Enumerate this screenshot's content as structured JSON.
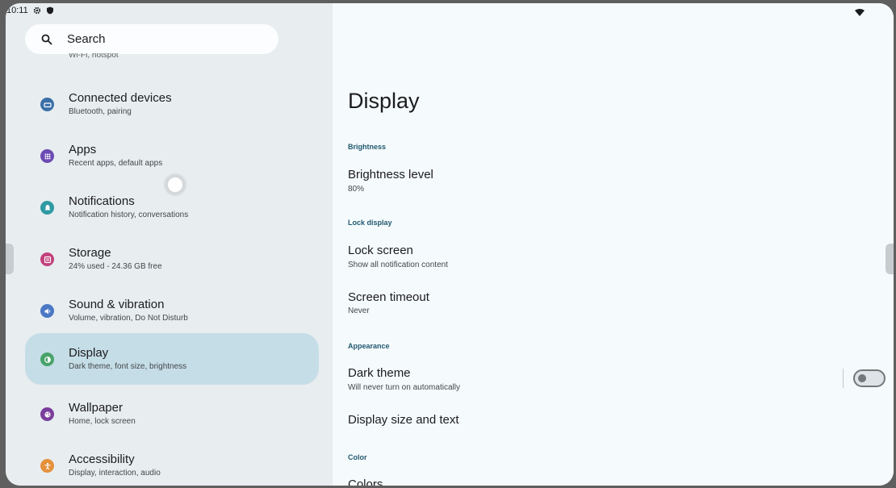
{
  "status_bar": {
    "time": "10:11",
    "icons": [
      "gear-icon",
      "shield-icon"
    ],
    "right_icons": [
      "wifi-icon"
    ]
  },
  "search": {
    "label": "Search",
    "icon": "search-icon"
  },
  "clipped_above": "Wi-Fi, hotspot",
  "sidebar": {
    "items": [
      {
        "title": "Connected devices",
        "subtitle": "Bluetooth, pairing",
        "icon": "connected-devices-icon",
        "color": "#3b6fa8"
      },
      {
        "title": "Apps",
        "subtitle": "Recent apps, default apps",
        "icon": "apps-icon",
        "color": "#6c4bb3"
      },
      {
        "title": "Notifications",
        "subtitle": "Notification history, conversations",
        "icon": "bell-icon",
        "color": "#2e9aa3"
      },
      {
        "title": "Storage",
        "subtitle": "24% used - 24.36 GB free",
        "icon": "storage-icon",
        "color": "#c2417b"
      },
      {
        "title": "Sound & vibration",
        "subtitle": "Volume, vibration, Do Not Disturb",
        "icon": "volume-icon",
        "color": "#4a78c4"
      },
      {
        "title": "Display",
        "subtitle": "Dark theme, font size, brightness",
        "icon": "brightness-icon",
        "color": "#48a36a",
        "selected": true
      },
      {
        "title": "Wallpaper",
        "subtitle": "Home, lock screen",
        "icon": "palette-icon",
        "color": "#7a3e9d"
      },
      {
        "title": "Accessibility",
        "subtitle": "Display, interaction, audio",
        "icon": "accessibility-icon",
        "color": "#e5913b"
      }
    ]
  },
  "main": {
    "title": "Display",
    "sections": {
      "brightness": "Brightness",
      "lock_display": "Lock display",
      "appearance": "Appearance",
      "color": "Color"
    },
    "prefs": {
      "brightness_level": {
        "title": "Brightness level",
        "subtitle": "80%"
      },
      "lock_screen": {
        "title": "Lock screen",
        "subtitle": "Show all notification content"
      },
      "screen_timeout": {
        "title": "Screen timeout",
        "subtitle": "Never"
      },
      "dark_theme": {
        "title": "Dark theme",
        "subtitle": "Will never turn on automatically",
        "enabled": false
      },
      "display_size": {
        "title": "Display size and text"
      },
      "colors": {
        "title": "Colors"
      }
    }
  }
}
